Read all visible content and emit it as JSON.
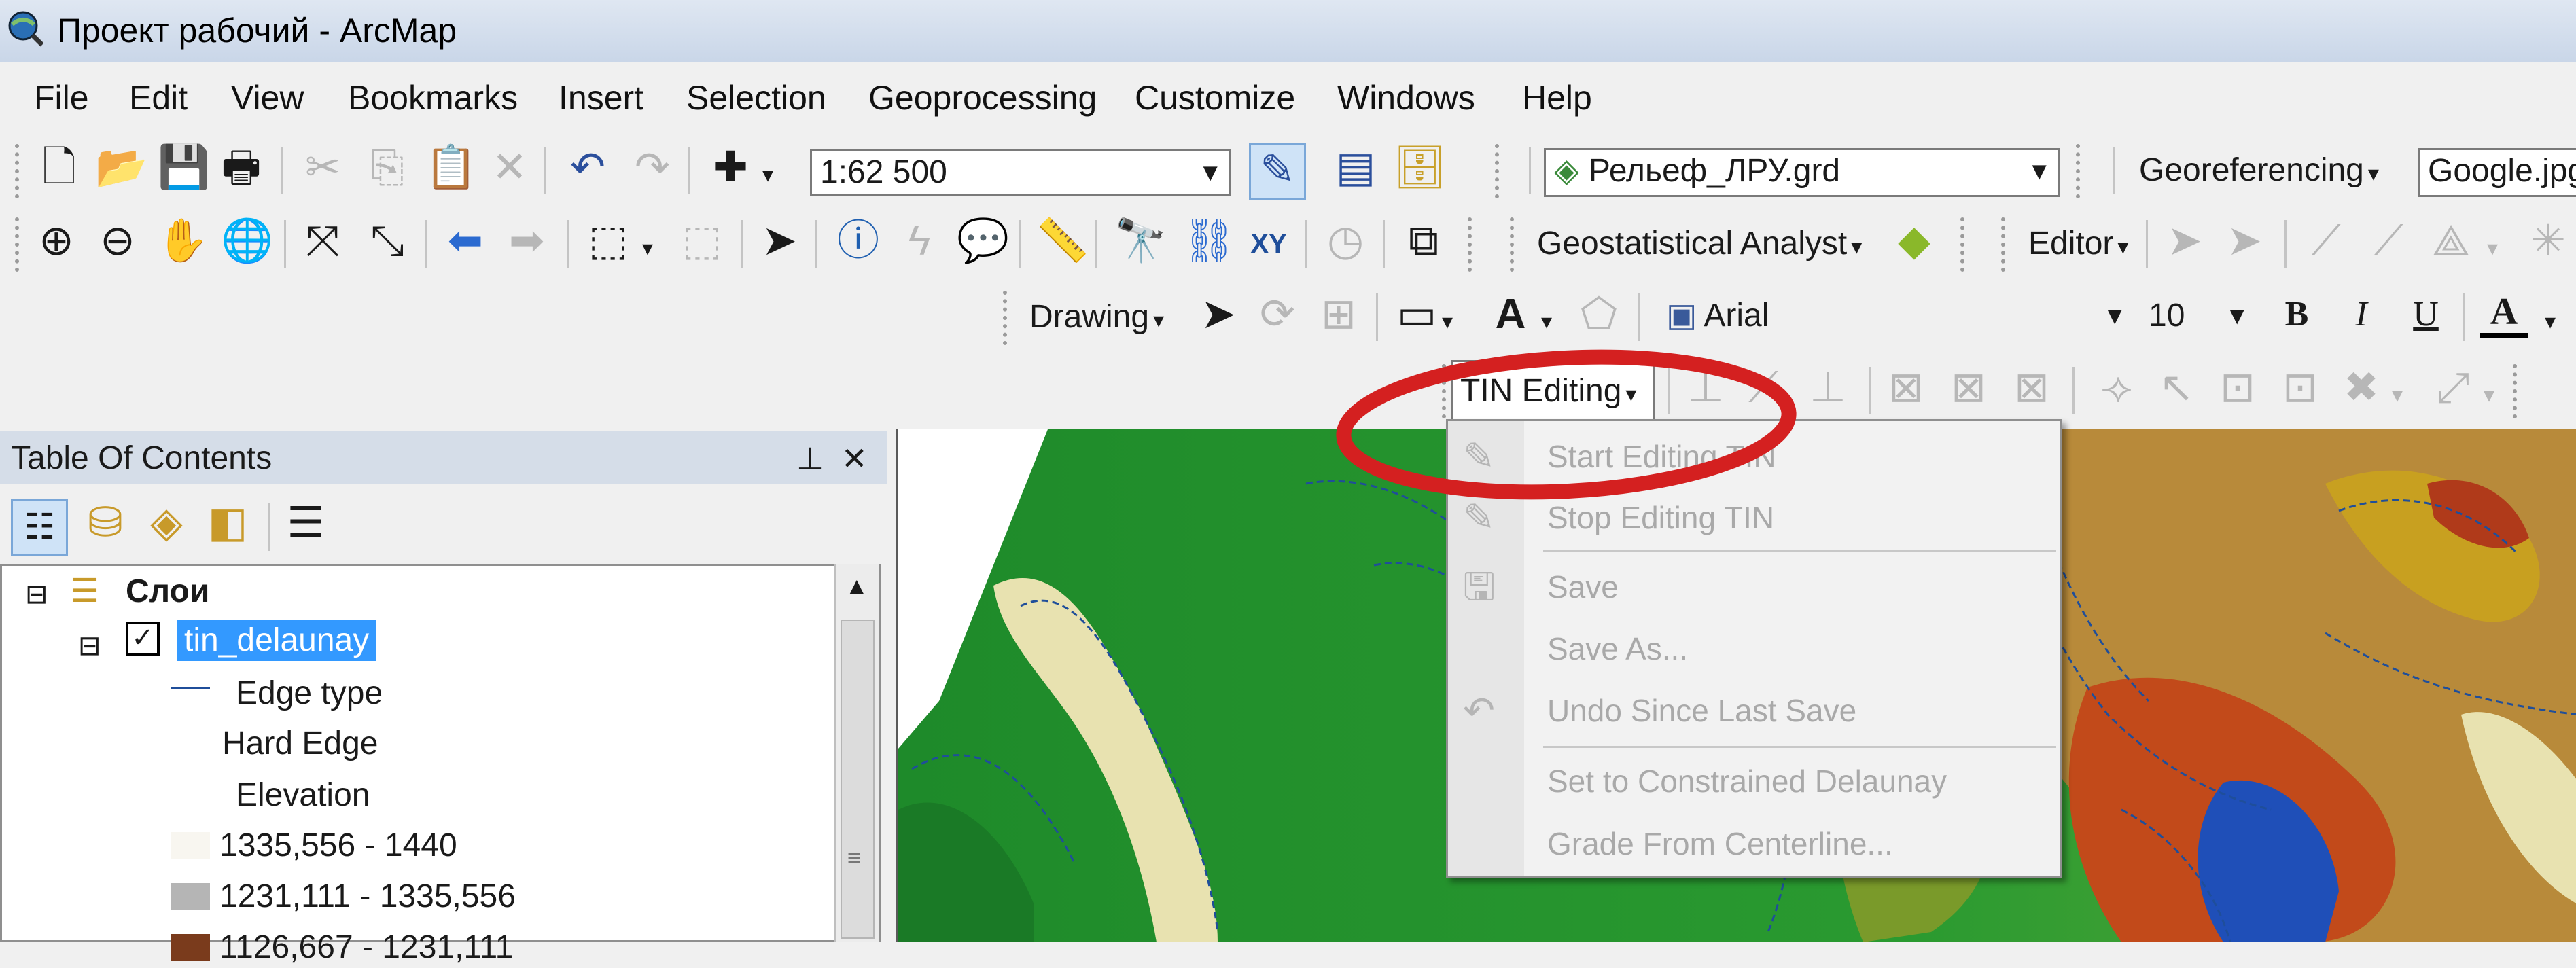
{
  "window": {
    "title": "Проект рабочий - ArcMap",
    "icon": "arcmap-globe-icon"
  },
  "menu": [
    "File",
    "Edit",
    "View",
    "Bookmarks",
    "Insert",
    "Selection",
    "Geoprocessing",
    "Customize",
    "Windows",
    "Help"
  ],
  "toolbar": {
    "scale_value": "1:62 500",
    "layer_combo": "Рельеф_ЛРУ.grd",
    "georeferencing_label": "Georeferencing",
    "georef_image": "Google.jpg",
    "geostat_label": "Geostatistical Analyst",
    "editor_label": "Editor",
    "drawing_label": "Drawing",
    "font_name": "Arial",
    "font_size": "10",
    "bold": "B",
    "italic": "I",
    "underline": "U",
    "font_color_letter": "A",
    "text_tool_letter": "A",
    "tin_editing_label": "TIN Editing",
    "xy_label": "XY"
  },
  "toc": {
    "title": "Table Of Contents",
    "pin_glyph": "⊥",
    "close_glyph": "✕",
    "expand_glyph": "⊟",
    "layers_root": "Слои",
    "layer_name": "tin_delaunay",
    "edge_type_heading": "Edge type",
    "hard_edge_label": "Hard Edge",
    "elevation_heading": "Elevation",
    "classes": [
      {
        "label": "1335,556 - 1440",
        "color": "#f8f6f0"
      },
      {
        "label": "1231,111 - 1335,556",
        "color": "#b5b5b5"
      },
      {
        "label": "1126,667 - 1231,111",
        "color": "#7a3b1c"
      }
    ]
  },
  "tin_menu": {
    "items": [
      {
        "label": "Start Editing TIN",
        "icon": "pencil-icon"
      },
      {
        "label": "Stop Editing TIN",
        "icon": "pencil-stop-icon"
      },
      {
        "label": "Save",
        "icon": "save-icon"
      },
      {
        "label": "Save As...",
        "icon": ""
      },
      {
        "label": "Undo Since Last Save",
        "icon": "undo-icon"
      },
      {
        "label": "Set to Constrained Delaunay",
        "icon": ""
      },
      {
        "label": "Grade From Centerline...",
        "icon": ""
      }
    ]
  },
  "colors": {
    "annotation_circle": "#d42020",
    "selection_highlight": "#3399ff",
    "hard_edge_line": "#1f4e9a"
  }
}
